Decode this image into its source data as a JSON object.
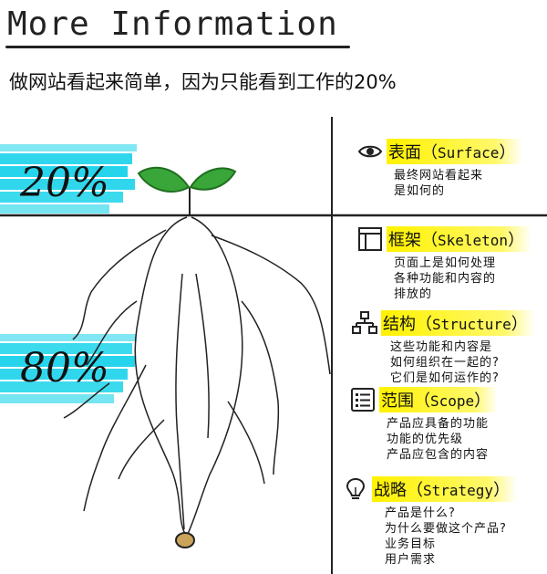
{
  "header": {
    "title": "More Information",
    "subtitle": "做网站看起来简单，因为只能看到工作的20%"
  },
  "plant": {
    "top_percent": "20%",
    "bottom_percent": "80%",
    "colors": {
      "cyan": "#1ad3ea",
      "leaf": "#3aa63a",
      "leaf_dark": "#1f6f1f",
      "highlight": "#fff200"
    }
  },
  "sections": [
    {
      "icon": "eye-icon",
      "title_cn": "表面",
      "title_en": "Surface",
      "lines": [
        "最终网站看起来",
        "是如何的"
      ]
    },
    {
      "icon": "layout-frame-icon",
      "title_cn": "框架",
      "title_en": "Skeleton",
      "lines": [
        "页面上是如何处理",
        "各种功能和内容的",
        "排放的"
      ]
    },
    {
      "icon": "hierarchy-icon",
      "title_cn": "结构",
      "title_en": "Structure",
      "lines": [
        "这些功能和内容是",
        "如何组织在一起的?",
        "它们是如何运作的?"
      ]
    },
    {
      "icon": "checklist-icon",
      "title_cn": "范围",
      "title_en": "Scope",
      "lines": [
        "产品应具备的功能",
        "功能的优先级",
        "产品应包含的内容"
      ]
    },
    {
      "icon": "lightbulb-icon",
      "title_cn": "战略",
      "title_en": "Strategy",
      "lines": [
        "产品是什么?",
        "为什么要做这个产品?",
        "业务目标",
        "用户需求"
      ]
    }
  ]
}
